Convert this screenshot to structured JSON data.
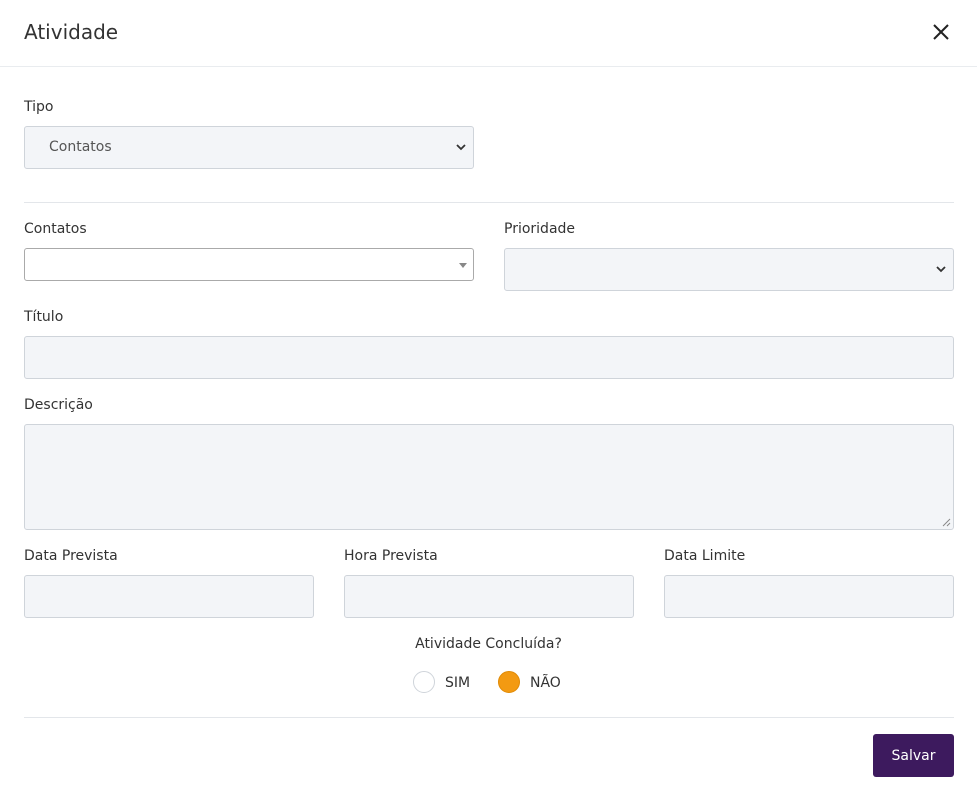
{
  "modal": {
    "title": "Atividade"
  },
  "form": {
    "tipo": {
      "label": "Tipo",
      "value": "Contatos"
    },
    "contatos": {
      "label": "Contatos",
      "value": ""
    },
    "prioridade": {
      "label": "Prioridade",
      "value": ""
    },
    "titulo": {
      "label": "Título",
      "value": ""
    },
    "descricao": {
      "label": "Descrição",
      "value": ""
    },
    "data_prevista": {
      "label": "Data Prevista",
      "value": ""
    },
    "hora_prevista": {
      "label": "Hora Prevista",
      "value": ""
    },
    "data_limite": {
      "label": "Data Limite",
      "value": ""
    },
    "concluida": {
      "label": "Atividade Concluída?",
      "options": [
        "SIM",
        "NÃO"
      ],
      "selected": "NÃO"
    }
  },
  "footer": {
    "save_label": "Salvar"
  },
  "colors": {
    "accent": "#f39a12",
    "save_button": "#3d1a5e",
    "field_bg": "#f3f5f8"
  }
}
